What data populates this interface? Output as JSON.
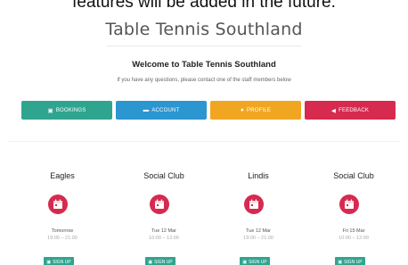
{
  "caption": "features will be added in the future.",
  "app_title": "Table Tennis Southland",
  "welcome": {
    "heading": "Welcome to Table Tennis Southland",
    "subtext": "If you have any questions, please contact one of the staff members below"
  },
  "actions": [
    {
      "label": "BOOKINGS",
      "icon": "calendar-icon",
      "color": "#2fa58f"
    },
    {
      "label": "ACCOUNT",
      "icon": "card-icon",
      "color": "#2b96d0"
    },
    {
      "label": "PROFILE",
      "icon": "user-icon",
      "color": "#f1a622"
    },
    {
      "label": "FEEDBACK",
      "icon": "megaphone-icon",
      "color": "#d62a4f"
    }
  ],
  "sessions": [
    {
      "venue": "Eagles",
      "date": "Tomorrow",
      "time": "19:00 – 21:00",
      "button": "SIGN UP"
    },
    {
      "venue": "Social Club",
      "date": "Tue 12 Mar",
      "time": "10:00 – 12:00",
      "button": "SIGN UP"
    },
    {
      "venue": "Lindis",
      "date": "Tue 12 Mar",
      "time": "19:00 – 21:00",
      "button": "SIGN UP"
    },
    {
      "venue": "Social Club",
      "date": "Fri 15 Mar",
      "time": "10:00 – 12:00",
      "button": "SIGN UP"
    }
  ],
  "colors": {
    "accent_red": "#d62a4f",
    "accent_green": "#2fa58f",
    "accent_blue": "#2b96d0",
    "accent_orange": "#f1a622"
  }
}
